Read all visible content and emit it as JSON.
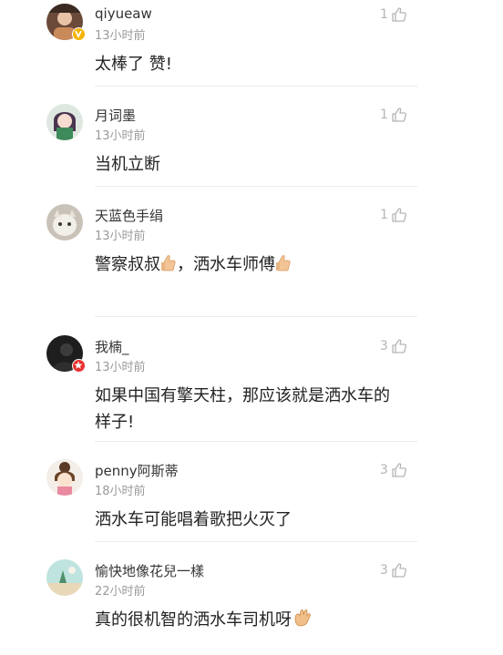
{
  "comments": [
    {
      "username": "qiyueaw",
      "time": "13小时前",
      "likes": "1",
      "text": "太棒了 赞!",
      "badge": "gold-v-badge"
    },
    {
      "username": "月词墨",
      "time": "13小时前",
      "likes": "1",
      "text": "当机立断"
    },
    {
      "username": "天蓝色手绢",
      "time": "13小时前",
      "likes": "1",
      "text_parts": [
        "警察叔叔",
        "，洒水车师傅"
      ],
      "emoji": "thumbs-up-emoji"
    },
    {
      "username": "我楠_",
      "time": "13小时前",
      "likes": "3",
      "text_line1": "如果中国有擎天柱，那应该就是洒水车的",
      "text_line2": "样子!",
      "badge": "red-star-badge"
    },
    {
      "username": "penny阿斯蒂",
      "time": "18小时前",
      "likes": "3",
      "text": "洒水车可能唱着歌把火灭了"
    },
    {
      "username": "愉快地像花兒一樣",
      "time": "22小时前",
      "likes": "3",
      "text": "真的很机智的洒水车司机呀",
      "emoji": "clapping-hands-emoji"
    }
  ],
  "colors": {
    "muted": "#9a9a9a",
    "like_icon": "#b5b5b5",
    "divider": "#ececec",
    "gold_badge": "#f5b400",
    "red_badge": "#e8312f"
  }
}
